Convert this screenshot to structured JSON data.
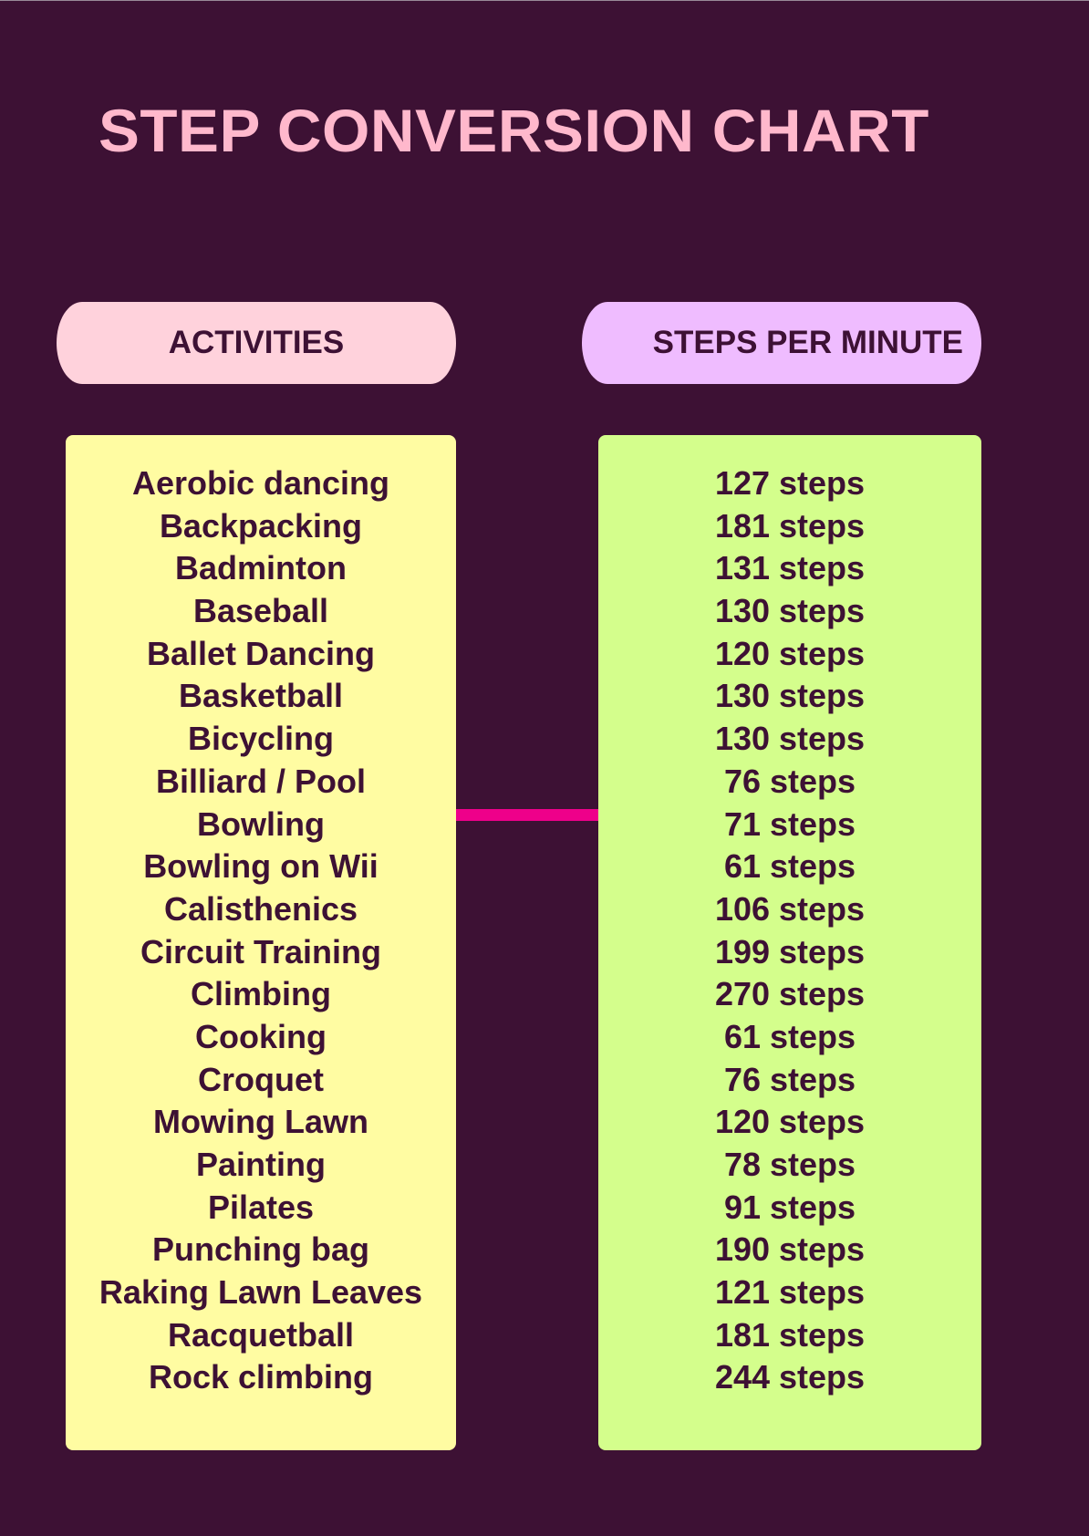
{
  "title": "STEP CONVERSION CHART",
  "headers": {
    "activities": "ACTIVITIES",
    "steps_per_minute": "STEPS PER MINUTE"
  },
  "colors": {
    "background": "#3d1134",
    "title": "#ffb8cc",
    "activities_header": "#ffd2dc",
    "steps_header": "#efbcff",
    "activities_panel": "#fffca2",
    "steps_panel": "#d4fe8c",
    "connector": "#ee008a",
    "text": "#3d1134"
  },
  "rows": [
    {
      "activity": "Aerobic dancing",
      "steps": "127 steps"
    },
    {
      "activity": "Backpacking",
      "steps": "181 steps"
    },
    {
      "activity": "Badminton",
      "steps": "131 steps"
    },
    {
      "activity": "Baseball",
      "steps": "130 steps"
    },
    {
      "activity": "Ballet Dancing",
      "steps": "120 steps"
    },
    {
      "activity": "Basketball",
      "steps": "130 steps"
    },
    {
      "activity": "Bicycling",
      "steps": "130 steps"
    },
    {
      "activity": "Billiard / Pool",
      "steps": "76 steps"
    },
    {
      "activity": "Bowling",
      "steps": "71 steps"
    },
    {
      "activity": "Bowling on Wii",
      "steps": "61 steps"
    },
    {
      "activity": "Calisthenics",
      "steps": "106 steps"
    },
    {
      "activity": "Circuit Training",
      "steps": "199 steps"
    },
    {
      "activity": "Climbing",
      "steps": "270 steps"
    },
    {
      "activity": "Cooking",
      "steps": "61 steps"
    },
    {
      "activity": "Croquet",
      "steps": "76 steps"
    },
    {
      "activity": "Mowing Lawn",
      "steps": "120 steps"
    },
    {
      "activity": "Painting",
      "steps": "78 steps"
    },
    {
      "activity": "Pilates",
      "steps": "91 steps"
    },
    {
      "activity": "Punching bag",
      "steps": "190 steps"
    },
    {
      "activity": "Raking Lawn Leaves",
      "steps": "121 steps"
    },
    {
      "activity": "Racquetball",
      "steps": "181 steps"
    },
    {
      "activity": "Rock climbing",
      "steps": "244 steps"
    }
  ]
}
